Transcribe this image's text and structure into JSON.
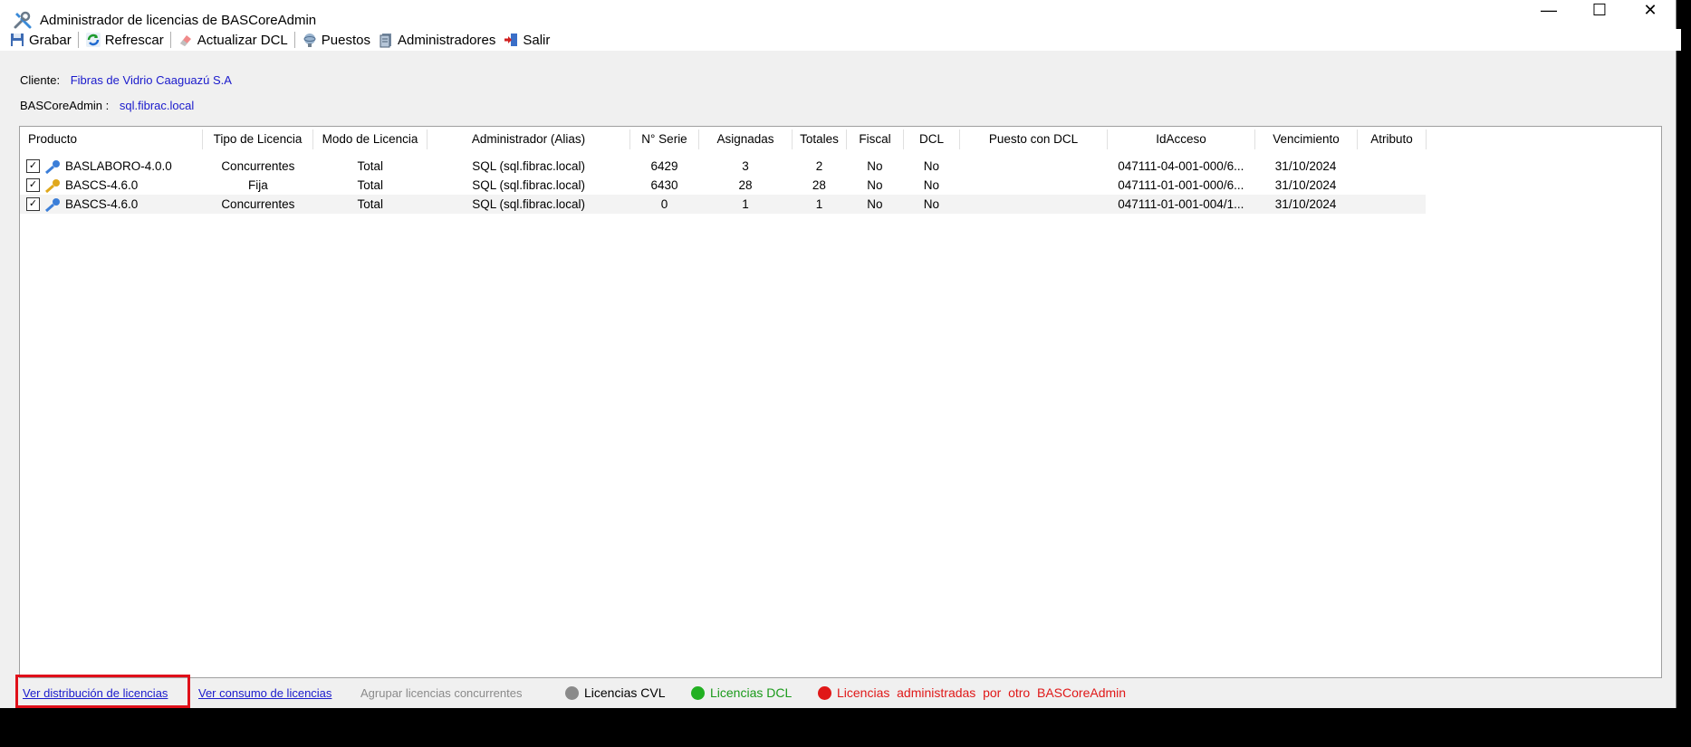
{
  "window": {
    "title": "Administrador de licencias de BASCoreAdmin"
  },
  "window_controls": {
    "minimize": "—",
    "maximize": "☐",
    "close": "✕"
  },
  "toolbar": {
    "items": [
      {
        "label": "Grabar",
        "icon": "floppy-disk-icon"
      },
      {
        "label": "Refrescar",
        "icon": "refresh-icon"
      },
      {
        "label": "Actualizar DCL",
        "icon": "eraser-icon"
      },
      {
        "label": "Puestos",
        "icon": "workstation-icon"
      },
      {
        "label": "Administradores",
        "icon": "server-icon"
      },
      {
        "label": "Salir",
        "icon": "exit-icon"
      }
    ]
  },
  "info": {
    "cliente_label": "Cliente:",
    "cliente_value": "Fibras de Vidrio Caaguazú S.A",
    "bascoreadmin_label": "BASCoreAdmin :",
    "bascoreadmin_value": "sql.fibrac.local"
  },
  "table": {
    "columns": [
      "Producto",
      "Tipo de Licencia",
      "Modo de Licencia",
      "Administrador (Alias)",
      "N° Serie",
      "Asignadas",
      "Totales",
      "Fiscal",
      "DCL",
      "Puesto con DCL",
      "IdAcceso",
      "Vencimiento",
      "Atributo"
    ],
    "rows": [
      {
        "checked": true,
        "key_color": "#3b7ed8",
        "producto": "BASLABORO-4.0.0",
        "tipo": "Concurrentes",
        "modo": "Total",
        "admin": "SQL (sql.fibrac.local)",
        "serie": "6429",
        "asignadas": "3",
        "totales": "2",
        "fiscal": "No",
        "dcl": "No",
        "puesto": "",
        "idacceso": "047111-04-001-000/6...",
        "vencimiento": "31/10/2024",
        "atributo": ""
      },
      {
        "checked": true,
        "key_color": "#e0a81c",
        "producto": "BASCS-4.6.0",
        "tipo": "Fija",
        "modo": "Total",
        "admin": "SQL (sql.fibrac.local)",
        "serie": "6430",
        "asignadas": "28",
        "totales": "28",
        "fiscal": "No",
        "dcl": "No",
        "puesto": "",
        "idacceso": "047111-01-001-000/6...",
        "vencimiento": "31/10/2024",
        "atributo": ""
      },
      {
        "checked": true,
        "key_color": "#3b7ed8",
        "producto": "BASCS-4.6.0",
        "tipo": "Concurrentes",
        "modo": "Total",
        "admin": "SQL (sql.fibrac.local)",
        "serie": "0",
        "asignadas": "1",
        "totales": "1",
        "fiscal": "No",
        "dcl": "No",
        "puesto": "",
        "idacceso": "047111-01-001-004/1...",
        "vencimiento": "31/10/2024",
        "atributo": ""
      }
    ]
  },
  "footer": {
    "link_distribucion": "Ver distribución de licencias",
    "link_consumo": "Ver consumo de licencias",
    "agrupar": "Agrupar licencias concurrentes",
    "legend": [
      {
        "label": "Licencias CVL",
        "color": "#8a8a8a",
        "text_color": "#000000"
      },
      {
        "label": "Licencias DCL",
        "color": "#22b022",
        "text_color": "#1a9a1a"
      },
      {
        "label": "Licencias  administradas  por  otro  BASCoreAdmin",
        "color": "#e01818",
        "text_color": "#e01818"
      }
    ]
  },
  "colors": {
    "link": "#1a1acc",
    "highlight": "#e0101a"
  }
}
